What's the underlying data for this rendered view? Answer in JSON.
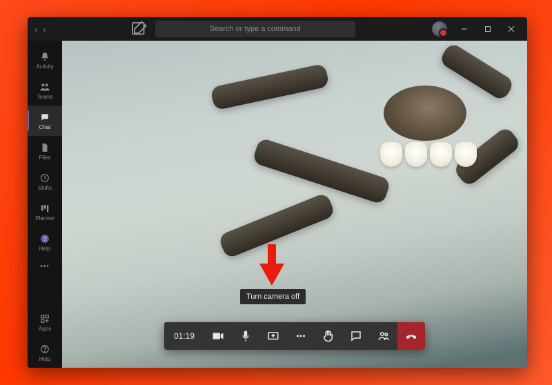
{
  "titlebar": {
    "search_placeholder": "Search or type a command"
  },
  "rail": {
    "items": [
      {
        "label": "Activity",
        "icon": "bell"
      },
      {
        "label": "Teams",
        "icon": "people"
      },
      {
        "label": "Chat",
        "icon": "chat",
        "active": true
      },
      {
        "label": "Files",
        "icon": "files"
      },
      {
        "label": "Shifts",
        "icon": "shifts"
      },
      {
        "label": "Planner",
        "icon": "planner"
      },
      {
        "label": "Help",
        "icon": "help-circle"
      }
    ],
    "bottom": [
      {
        "label": "Apps",
        "icon": "apps"
      },
      {
        "label": "Help",
        "icon": "help-circle"
      }
    ]
  },
  "call": {
    "timer": "01:19",
    "buttons": {
      "camera": "camera-icon",
      "mic": "mic-icon",
      "share": "share-screen-icon",
      "more": "more-icon",
      "raise_hand": "raise-hand-icon",
      "chat": "chat-icon",
      "people": "people-icon",
      "hangup": "hangup-icon"
    }
  },
  "tooltip": {
    "camera": "Turn camera off"
  },
  "annotation": {
    "arrow_target": "camera-button"
  }
}
